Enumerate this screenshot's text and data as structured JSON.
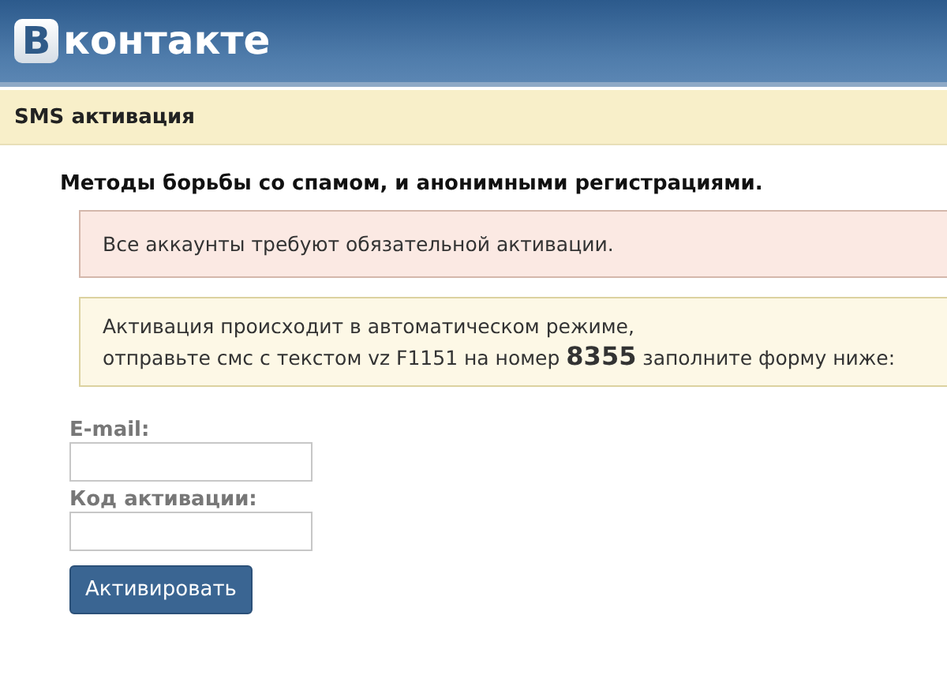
{
  "header": {
    "logo_letter": "В",
    "logo_text": "контакте"
  },
  "section_bar": {
    "title": "SMS активация"
  },
  "heading": "Методы борьбы со спамом, и анонимными регистрациями.",
  "notices": [
    {
      "kind": "error",
      "lines": [
        "Все аккаунты требуют обязательной активации."
      ]
    },
    {
      "kind": "info",
      "lines": [
        "Активация происходит в автоматическом режиме,",
        "отправьте смс с текстом vz F1151 на номер **8355** заполните форму ниже:"
      ]
    }
  ],
  "form": {
    "fields": [
      {
        "label": "E-mail:"
      },
      {
        "label": "Код активации:"
      }
    ],
    "button": "Активировать"
  }
}
